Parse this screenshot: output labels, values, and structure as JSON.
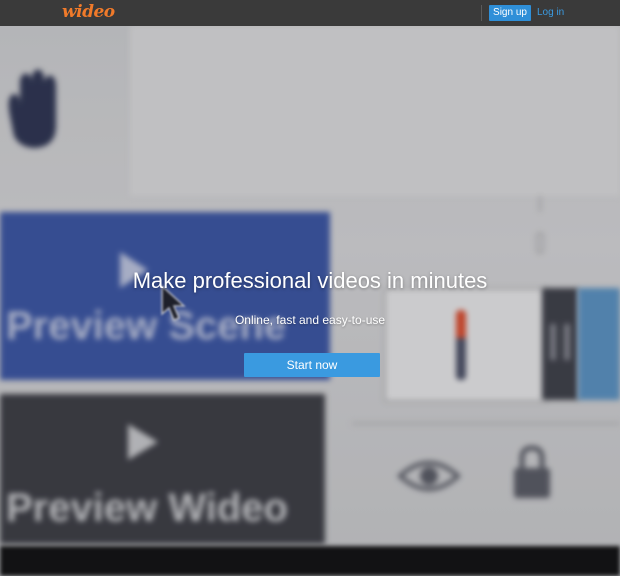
{
  "nav": {
    "logo": "wideo",
    "signup_label": "Sign up",
    "login_label": "Log in"
  },
  "hero": {
    "headline": "Make professional videos in minutes",
    "subline": "Online, fast and easy-to-use",
    "cta_label": "Start now"
  },
  "background": {
    "scene_button_text": "Preview Scene",
    "video_button_text": "Preview Wideo"
  },
  "icons": {
    "hand": "hand-icon",
    "play": "play-icon",
    "pause": "pause-icon",
    "eye": "eye-icon",
    "lock": "lock-icon",
    "cursor": "cursor-icon"
  },
  "colors": {
    "brand_orange": "#f07a2a",
    "accent_blue": "#3a9ae0",
    "nav_bg": "#3a3a3a",
    "scene_blue": "#3a56a8"
  }
}
